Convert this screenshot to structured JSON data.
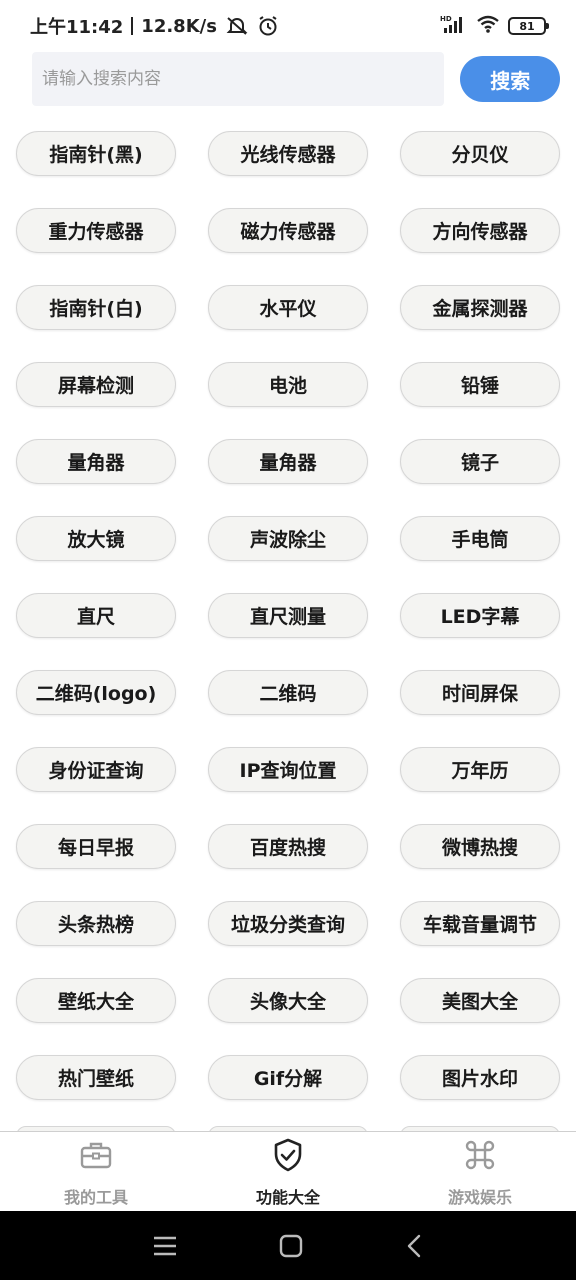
{
  "status_bar": {
    "time": "上午11:42",
    "speed": "12.8K/s",
    "battery": "81"
  },
  "search": {
    "placeholder": "请输入搜索内容",
    "button_label": "搜索"
  },
  "tools": [
    "指南针(黑)",
    "光线传感器",
    "分贝仪",
    "重力传感器",
    "磁力传感器",
    "方向传感器",
    "指南针(白)",
    "水平仪",
    "金属探测器",
    "屏幕检测",
    "电池",
    "铅锤",
    "量角器",
    "量角器",
    "镜子",
    "放大镜",
    "声波除尘",
    "手电筒",
    "直尺",
    "直尺测量",
    "LED字幕",
    "二维码(logo)",
    "二维码",
    "时间屏保",
    "身份证查询",
    "IP查询位置",
    "万年历",
    "每日早报",
    "百度热搜",
    "微博热搜",
    "头条热榜",
    "垃圾分类查询",
    "车载音量调节",
    "壁纸大全",
    "头像大全",
    "美图大全",
    "热门壁纸",
    "Gif分解",
    "图片水印"
  ],
  "bottom_nav": {
    "items": [
      {
        "label": "我的工具",
        "icon": "briefcase-icon",
        "active": false
      },
      {
        "label": "功能大全",
        "icon": "shield-check-icon",
        "active": true
      },
      {
        "label": "游戏娱乐",
        "icon": "command-icon",
        "active": false
      }
    ]
  },
  "colors": {
    "accent": "#4a8fe8",
    "button_bg": "#f4f4f2",
    "inactive": "#9a9a9a"
  }
}
